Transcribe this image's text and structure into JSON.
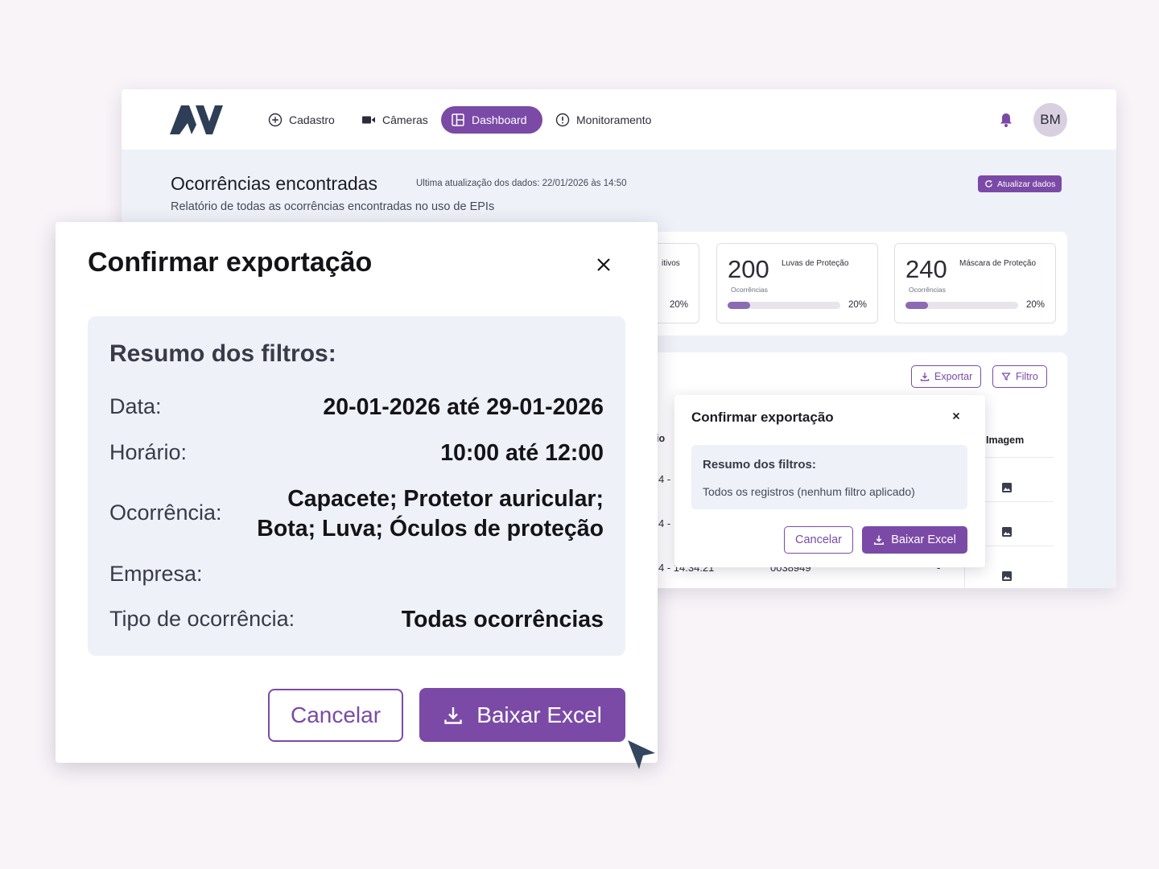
{
  "app": {
    "logo_text": "AV",
    "nav": [
      {
        "label": "Cadastro",
        "icon": "plus-circle-icon"
      },
      {
        "label": "Câmeras",
        "icon": "video-camera-icon"
      },
      {
        "label": "Dashboard",
        "icon": "dashboard-layout-icon",
        "active": true
      },
      {
        "label": "Monitoramento",
        "icon": "alert-circle-icon"
      }
    ],
    "user_initials": "BM",
    "colors": {
      "accent": "#7b4aa6",
      "page_bg": "#eef1f8"
    }
  },
  "page": {
    "title": "Ocorrências encontradas",
    "last_update": "Ultima atualização dos dados: 22/01/2026 às 14:50",
    "subtitle": "Relatório de todas as ocorrências encontradas no uso de EPIs",
    "refresh_label": "Atualizar dados"
  },
  "stats": [
    {
      "value": "",
      "name": "itivos",
      "sub": "",
      "percent_label": "20%",
      "percent": 20
    },
    {
      "value": "200",
      "name": "Luvas de Proteção",
      "sub": "Ocorrências",
      "percent_label": "20%",
      "percent": 20
    },
    {
      "value": "240",
      "name": "Máscara de Proteção",
      "sub": "Ocorrências",
      "percent_label": "20%",
      "percent": 20
    }
  ],
  "table": {
    "export_label": "Exportar",
    "filter_label": "Filtro",
    "header_fragment": "io",
    "image_column": "Imagem",
    "row_fragments": [
      "4 -",
      "4 -",
      "4 - 14:34:21"
    ],
    "last_row_id": "0038949",
    "last_row_dash": "-"
  },
  "mini_dialog": {
    "title": "Confirmar exportação",
    "summary_title": "Resumo dos filtros:",
    "summary_text": "Todos os registros (nenhum filtro aplicado)",
    "cancel_label": "Cancelar",
    "download_label": "Baixar Excel"
  },
  "dialog": {
    "title": "Confirmar exportação",
    "summary_title": "Resumo dos filtros:",
    "rows": [
      {
        "label": "Data:",
        "value": "20-01-2026 até 29-01-2026"
      },
      {
        "label": "Horário:",
        "value": "10:00 até 12:00"
      },
      {
        "label": "Ocorrência:",
        "value_line1": "Capacete; Protetor auricular;",
        "value_line2": "Bota; Luva; Óculos de proteção"
      },
      {
        "label": "Empresa:",
        "value": ""
      },
      {
        "label": "Tipo de ocorrência:",
        "value": "Todas ocorrências"
      }
    ],
    "cancel_label": "Cancelar",
    "download_label": "Baixar Excel"
  }
}
